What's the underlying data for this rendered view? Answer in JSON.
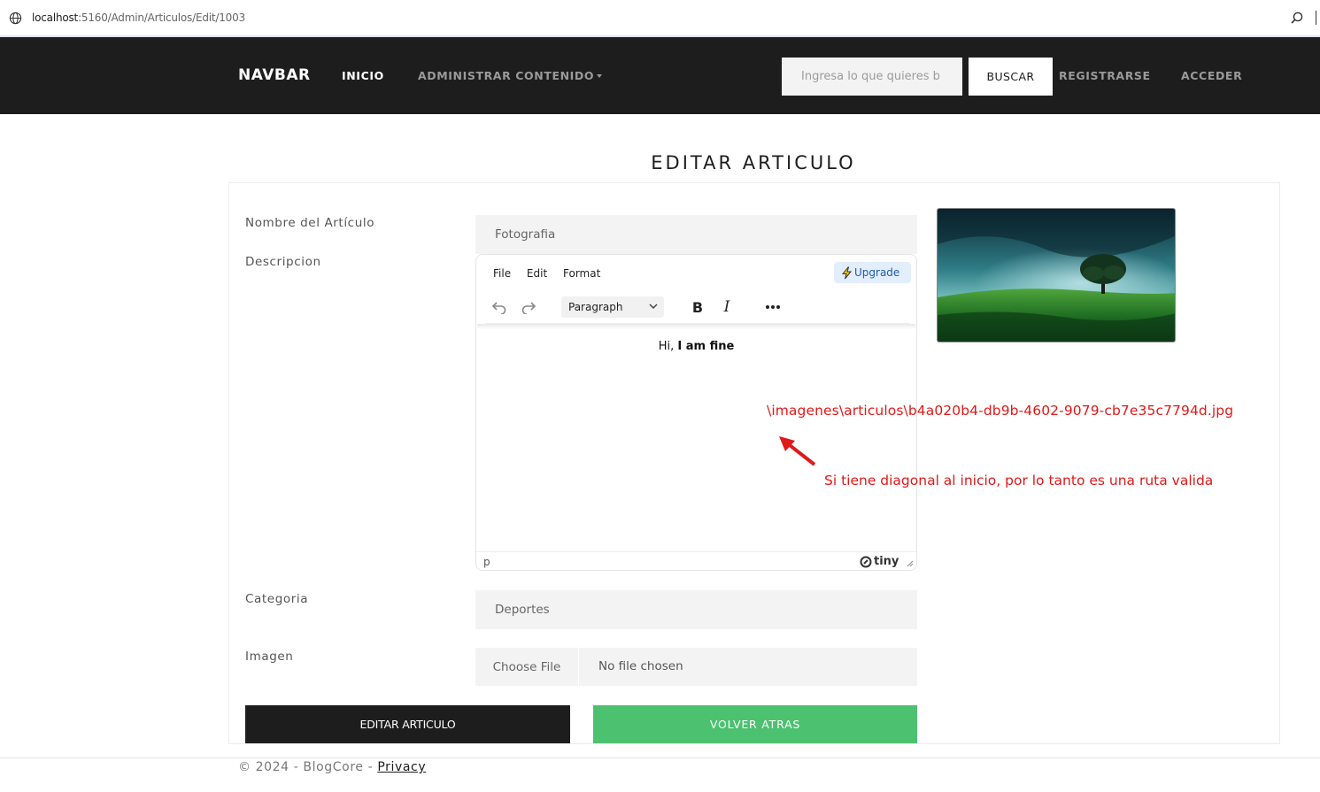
{
  "browser": {
    "url_host": "localhost",
    "url_rest": ":5160/Admin/Articulos/Edit/1003"
  },
  "navbar": {
    "brand": "NAVBAR",
    "inicio": "INICIO",
    "administrar": "ADMINISTRAR CONTENIDO",
    "search_placeholder": "Ingresa lo que quieres b",
    "search_button": "BUSCAR",
    "registrarse": "REGISTRARSE",
    "acceder": "ACCEDER"
  },
  "page": {
    "title": "EDITAR ARTICULO"
  },
  "form": {
    "nombre_label": "Nombre del Artículo",
    "nombre_value": "Fotografia",
    "descripcion_label": "Descripcion",
    "categoria_label": "Categoria",
    "categoria_value": "Deportes",
    "imagen_label": "Imagen",
    "choose_file": "Choose File",
    "no_file": "No file chosen",
    "submit": "EDITAR ARTICULO",
    "back": "VOLVER ATRAS"
  },
  "editor": {
    "menu": [
      "File",
      "Edit",
      "Format"
    ],
    "upgrade": "Upgrade",
    "block_format": "Paragraph",
    "content_plain": "Hi, ",
    "content_bold": "I am fine",
    "status_path": "p",
    "brand": "tiny"
  },
  "annotations": {
    "path": "\\imagenes\\articulos\\b4a020b4-db9b-4602-9079-cb7e35c7794d.jpg",
    "note": "Si tiene diagonal al inicio, por lo tanto es una ruta valida",
    "color": "#e01919"
  },
  "footer": {
    "text": "© 2024 - BlogCore - ",
    "privacy": "Privacy"
  },
  "colors": {
    "navbar_bg": "#1d1d1d",
    "back_button": "#4cc170",
    "upgrade_text": "#1e5cb3"
  }
}
